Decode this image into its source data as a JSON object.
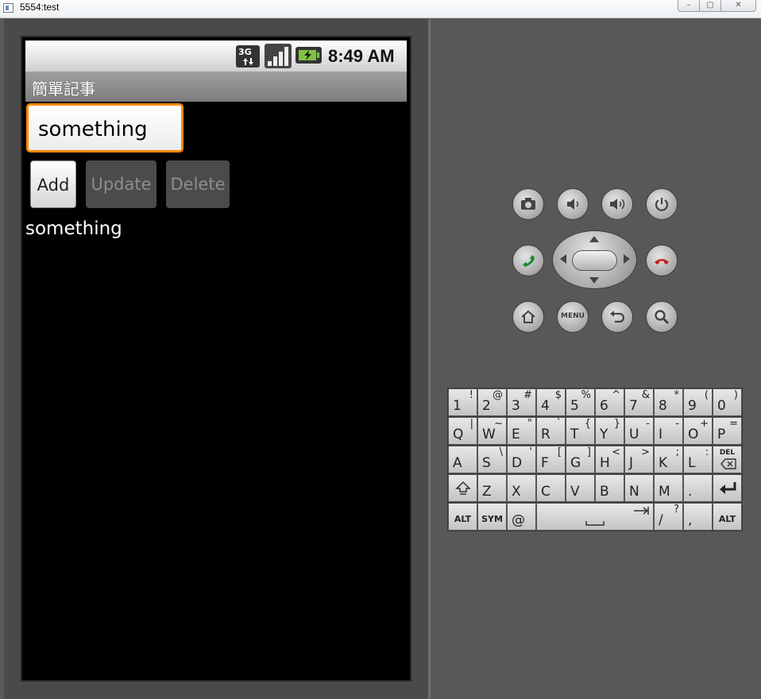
{
  "window": {
    "title": "5554:test",
    "controls": {
      "minimize": "–",
      "maximize": "▢",
      "close": "✕"
    }
  },
  "phone": {
    "status_bar": {
      "network": "3G",
      "time": "8:49 AM"
    },
    "app_title": "簡單記事",
    "input": {
      "value": "something"
    },
    "buttons": {
      "add": "Add",
      "update": "Update",
      "delete": "Delete"
    },
    "list_items": [
      "something"
    ]
  },
  "hardware_buttons": {
    "menu_label": "MENU",
    "icons": [
      "camera-icon",
      "volume-down-icon",
      "volume-up-icon",
      "power-icon",
      "call-icon",
      "end-call-icon",
      "home-icon",
      "back-icon",
      "search-icon"
    ]
  },
  "keyboard": {
    "row1": [
      {
        "main": "1",
        "alt": "!"
      },
      {
        "main": "2",
        "alt": "@"
      },
      {
        "main": "3",
        "alt": "#"
      },
      {
        "main": "4",
        "alt": "$"
      },
      {
        "main": "5",
        "alt": "%"
      },
      {
        "main": "6",
        "alt": "^"
      },
      {
        "main": "7",
        "alt": "&"
      },
      {
        "main": "8",
        "alt": "*"
      },
      {
        "main": "9",
        "alt": "("
      },
      {
        "main": "0",
        "alt": ")"
      }
    ],
    "row2": [
      {
        "main": "Q",
        "alt": "|"
      },
      {
        "main": "W",
        "alt": "~"
      },
      {
        "main": "E",
        "alt": "\""
      },
      {
        "main": "R",
        "alt": "`"
      },
      {
        "main": "T",
        "alt": "{"
      },
      {
        "main": "Y",
        "alt": "}"
      },
      {
        "main": "U",
        "alt": "-"
      },
      {
        "main": "I",
        "alt": "-"
      },
      {
        "main": "O",
        "alt": "+"
      },
      {
        "main": "P",
        "alt": "="
      }
    ],
    "row3": [
      {
        "main": "A",
        "alt": ""
      },
      {
        "main": "S",
        "alt": "\\"
      },
      {
        "main": "D",
        "alt": "'"
      },
      {
        "main": "F",
        "alt": "["
      },
      {
        "main": "G",
        "alt": "]"
      },
      {
        "main": "H",
        "alt": "<"
      },
      {
        "main": "J",
        "alt": ">"
      },
      {
        "main": "K",
        "alt": ";"
      },
      {
        "main": "L",
        "alt": ":"
      }
    ],
    "row4": [
      {
        "main": "Z"
      },
      {
        "main": "X"
      },
      {
        "main": "C"
      },
      {
        "main": "V"
      },
      {
        "main": "B"
      },
      {
        "main": "N"
      },
      {
        "main": "M"
      },
      {
        "main": "."
      }
    ],
    "del_label": "DEL",
    "alt_label": "ALT",
    "sym_label": "SYM",
    "at_key": "@",
    "slash_key": {
      "main": "/",
      "alt": "?"
    },
    "comma_key": ","
  }
}
